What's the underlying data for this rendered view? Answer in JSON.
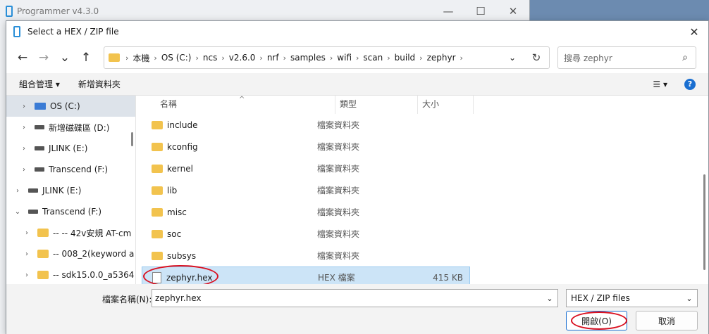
{
  "parent_window": {
    "title": "Programmer v4.3.0",
    "minimize": "—",
    "maximize": "☐",
    "close": "✕"
  },
  "dialog": {
    "title": "Select a HEX / ZIP file",
    "close": "✕"
  },
  "nav": {
    "back": "←",
    "forward": "→",
    "recent": "⌄",
    "up": "↑",
    "breadcrumbs": [
      "本機",
      "OS (C:)",
      "ncs",
      "v2.6.0",
      "nrf",
      "samples",
      "wifi",
      "scan",
      "build",
      "zephyr"
    ],
    "search_placeholder": "搜尋 zephyr"
  },
  "toolbar": {
    "organize": "組合管理 ▾",
    "new_folder": "新增資料夾",
    "view": "☰ ▾",
    "help": "?"
  },
  "tree": [
    {
      "label": "OS (C:)",
      "icon": "os-drive-icon",
      "selected": true
    },
    {
      "label": "新增磁碟區 (D:)",
      "icon": "drive-icon"
    },
    {
      "label": "JLINK (E:)",
      "icon": "usb-drive-icon"
    },
    {
      "label": "Transcend (F:)",
      "icon": "usb-drive-icon"
    },
    {
      "label": "JLINK (E:)",
      "icon": "usb-drive-icon"
    },
    {
      "label": "Transcend (F:)",
      "icon": "usb-drive-icon",
      "expanded": true
    },
    {
      "label": "-- -- 42v安規 AT-cm",
      "icon": "folder-icon"
    },
    {
      "label": "-- 008_2(keyword a",
      "icon": "folder-icon"
    },
    {
      "label": "-- sdk15.0.0_a5364",
      "icon": "folder-icon"
    }
  ],
  "columns": {
    "name": "名稱",
    "type": "類型",
    "size": "大小"
  },
  "files": [
    {
      "name": "include",
      "type": "檔案資料夾",
      "size": "",
      "kind": "folder"
    },
    {
      "name": "kconfig",
      "type": "檔案資料夾",
      "size": "",
      "kind": "folder"
    },
    {
      "name": "kernel",
      "type": "檔案資料夾",
      "size": "",
      "kind": "folder"
    },
    {
      "name": "lib",
      "type": "檔案資料夾",
      "size": "",
      "kind": "folder"
    },
    {
      "name": "misc",
      "type": "檔案資料夾",
      "size": "",
      "kind": "folder"
    },
    {
      "name": "soc",
      "type": "檔案資料夾",
      "size": "",
      "kind": "folder"
    },
    {
      "name": "subsys",
      "type": "檔案資料夾",
      "size": "",
      "kind": "folder"
    },
    {
      "name": "zephyr.hex",
      "type": "HEX 檔案",
      "size": "415 KB",
      "kind": "file",
      "selected": true
    }
  ],
  "bottom": {
    "filename_label": "檔案名稱(N):",
    "filename_value": "zephyr.hex",
    "filetype_value": "HEX / ZIP files",
    "open_label": "開啟(O)",
    "cancel_label": "取消"
  },
  "colors": {
    "highlight_ring": "#d91020",
    "selection": "#cce4f7",
    "accent": "#1a6fd1"
  }
}
